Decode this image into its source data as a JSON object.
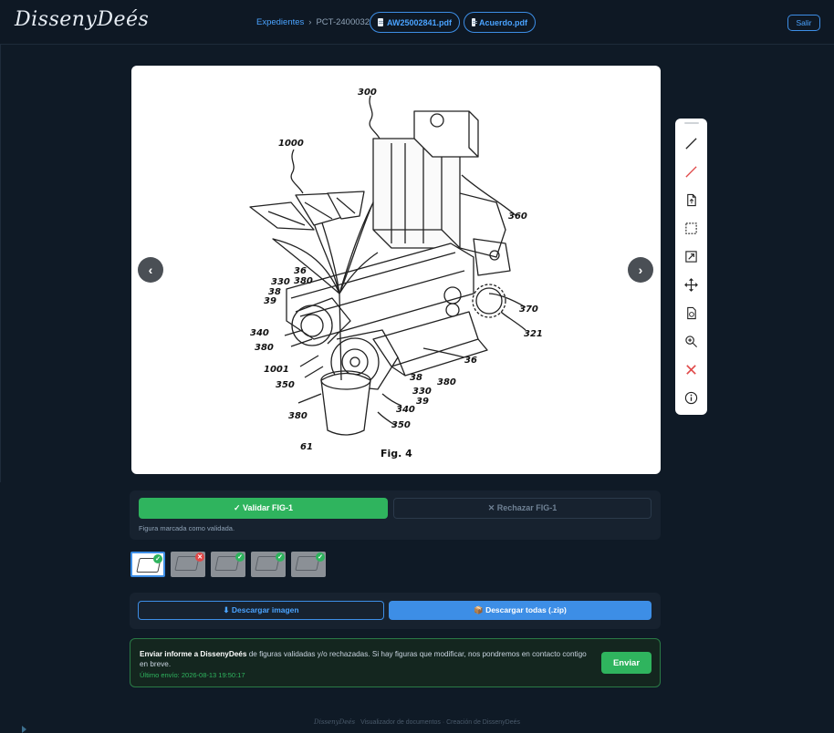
{
  "header": {
    "logo": "DissenyDeés",
    "breadcrumb_link": "Expedientes",
    "breadcrumb_sep": "›",
    "breadcrumb_current": "PCT-2400032",
    "file1": "AW25002841.pdf",
    "file2": "Acuerdo.pdf",
    "logout": "Salir"
  },
  "viewer": {
    "prev": "‹",
    "next": "›",
    "drawing_labels": {
      "l300": "300",
      "l1000": "1000",
      "l360": "360",
      "l36a": "36",
      "l380a": "380",
      "l330a": "330",
      "l38a": "38",
      "l39a": "39",
      "l340a": "340",
      "l380b": "380",
      "l1001": "1001",
      "l350a": "350",
      "l380c": "380",
      "l61": "61",
      "l370": "370",
      "l321": "321",
      "l36b": "36",
      "l38b": "38",
      "l380d": "380",
      "l330b": "330",
      "l39b": "39",
      "l340b": "340",
      "l350b": "350",
      "fig": "Fig. 4"
    }
  },
  "toolbar": {
    "tools": [
      "line-tool",
      "red-line-tool",
      "page-tool",
      "select-tool",
      "resize-tool",
      "move-tool",
      "rotate-tool",
      "zoom-tool",
      "delete-tool",
      "info-tool"
    ]
  },
  "validation": {
    "validate_label": "✓ Validar FIG-1",
    "reject_label": "✕ Rechazar FIG-1",
    "message": "Figura marcada como validada."
  },
  "thumbnails": [
    {
      "status": "ok",
      "active": true
    },
    {
      "status": "no",
      "active": false
    },
    {
      "status": "ok",
      "active": false
    },
    {
      "status": "ok",
      "active": false
    },
    {
      "status": "ok",
      "active": false
    }
  ],
  "downloads": {
    "image": "⬇ Descargar imagen",
    "all": "📦 Descargar todas (.zip)"
  },
  "report": {
    "title": "Enviar informe a DissenyDeés",
    "body": " de figuras validadas y/o rechazadas. Si hay figuras que modificar, nos pondremos en contacto contigo en breve.",
    "last_sent": "Último envío: 2026-08-13 19:50:17",
    "send": "Enviar"
  },
  "footer": {
    "logo": "DissenyDeés",
    "text": "Visualizador de documentos · Creación de DissenyDeés"
  },
  "colors": {
    "accent": "#3d8ee6",
    "success": "#2fb45e",
    "danger": "#e04848",
    "background": "#0f1a26"
  }
}
